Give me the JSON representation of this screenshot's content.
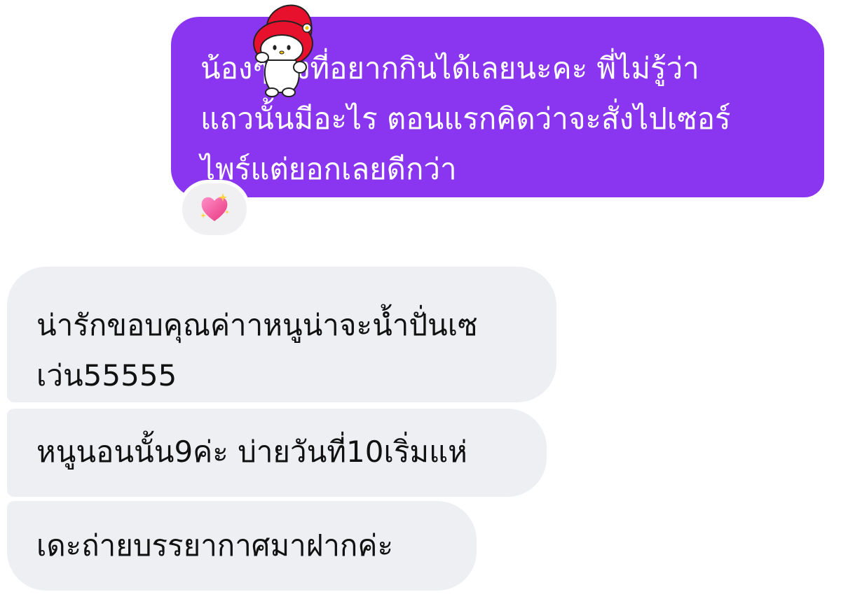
{
  "messages": {
    "outgoing": {
      "text": "น้องๆ สั่งที่อยากกินได้เลยนะคะ พี่ไม่รู้ว่า\nแถวนั้นมีอะไร ตอนแรกคิดว่าจะสั่งไปเซอร์\nไพร์แต่ยอกเลยดีกว่า",
      "bubble_color": "#8a36f1",
      "reaction_icon": "sparkling-heart-icon",
      "sticker_icon": "my-melody-sticker"
    },
    "incoming": [
      {
        "text": "น่ารักขอบคุณค่าาหนูน่าจะน้ำปั่นเซ\nเว่น55555"
      },
      {
        "text": "หนูนอนนั้น9ค่ะ บ่ายวันที่10เริ่มแห่"
      },
      {
        "text": "เดะถ่ายบรรยากาศมาฝากค่ะ"
      }
    ],
    "incoming_bubble_color": "#eeeff3"
  }
}
